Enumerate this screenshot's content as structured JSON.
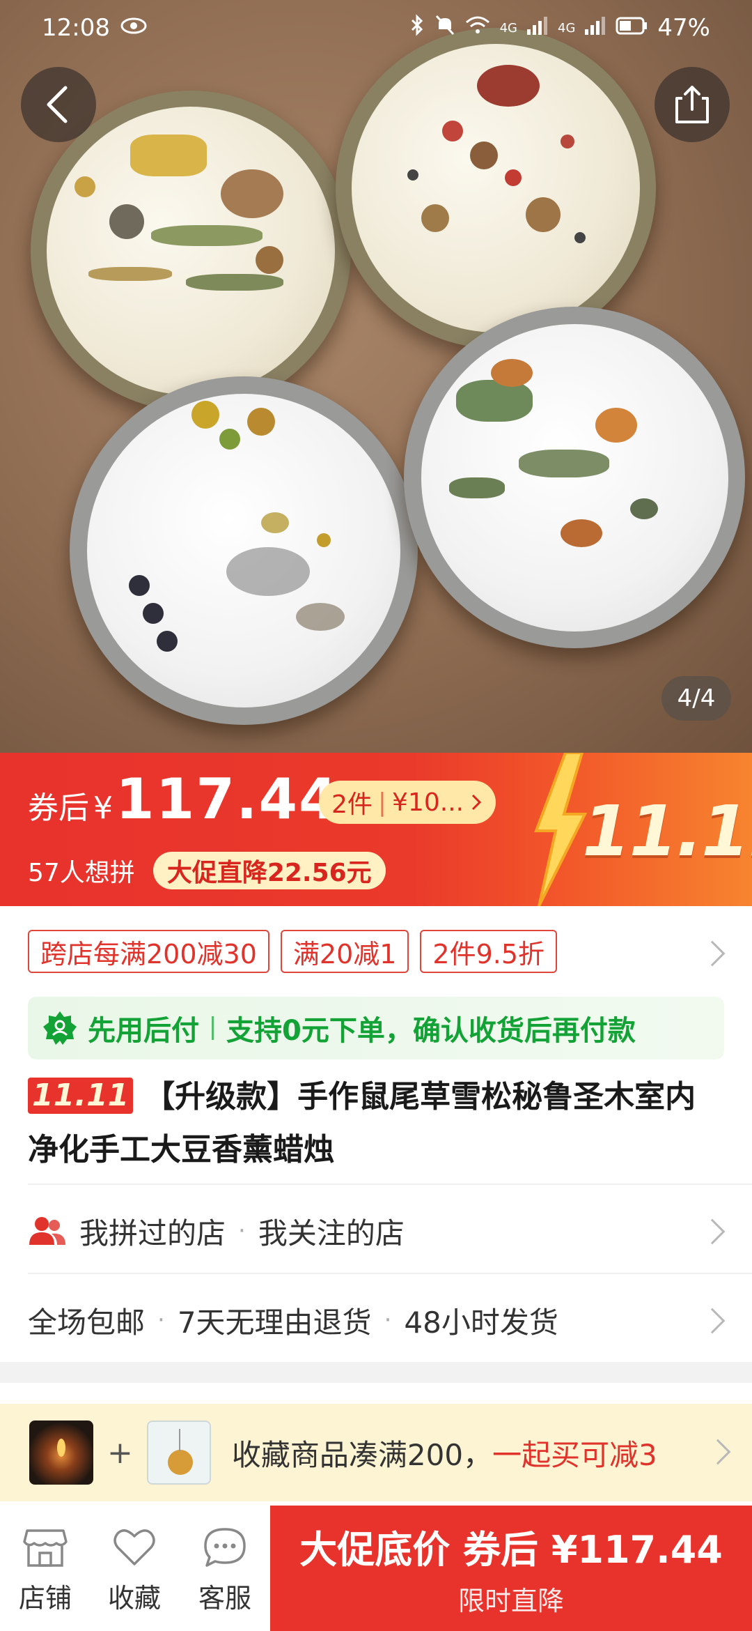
{
  "status_bar": {
    "time": "12:08",
    "battery": "47%",
    "network_1": "4G",
    "network_2": "4G"
  },
  "gallery": {
    "indicator": "4/4"
  },
  "price": {
    "prefix": "券后",
    "currency": "¥",
    "value": "117.44",
    "multi_buy_count": "2件",
    "multi_buy_price": "¥10...",
    "want_count": "57人想拼",
    "promo_drop": "大促直降22.56元",
    "festival_badge": "11.11"
  },
  "coupons": [
    {
      "label": "跨店每满200减30"
    },
    {
      "label": "满20减1"
    },
    {
      "label": "2件9.5折"
    }
  ],
  "pay_later": {
    "label": "先用后付",
    "text": "支持0元下单，确认收货后再付款"
  },
  "product": {
    "tag": "11.11",
    "title": "【升级款】手作鼠尾草雪松秘鲁圣木室内净化手工大豆香薰蜡烛"
  },
  "shops": {
    "visited": "我拼过的店",
    "followed": "我关注的店"
  },
  "services": [
    "全场包邮",
    "7天无理由退货",
    "48小时发货"
  ],
  "bundle": {
    "text": "收藏商品凑满200，",
    "highlight": "一起买可减3"
  },
  "bottom_nav": {
    "store": "店铺",
    "favorite": "收藏",
    "service": "客服",
    "cta_main": "大促底价 券后 ¥117.44",
    "cta_sub": "限时直降"
  },
  "colors": {
    "primary_red": "#e8322c",
    "pay_later_green": "#12a235",
    "promo_yellow": "#fff1c4"
  }
}
